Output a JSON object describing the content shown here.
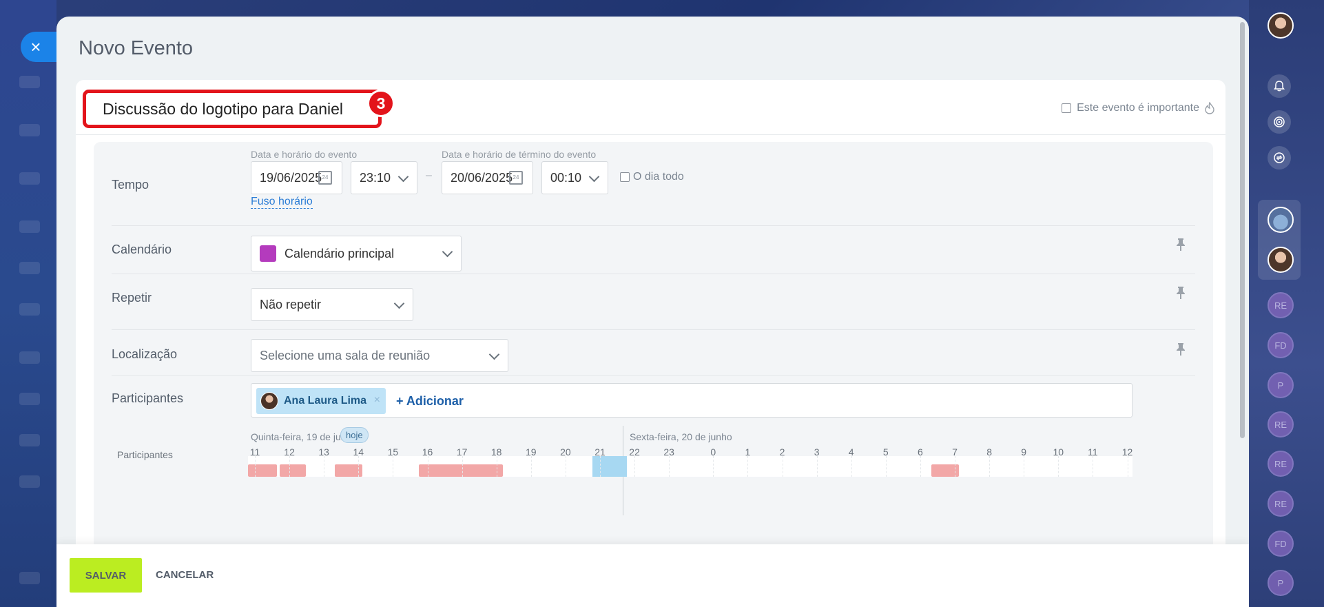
{
  "window": {
    "close_icon": "×"
  },
  "page": {
    "title": "Novo Evento"
  },
  "event": {
    "name": "Discussão do logotipo para Daniel",
    "step_badge": "3",
    "important_label": "Este evento é importante",
    "important_checked": false
  },
  "form": {
    "time": {
      "label": "Tempo",
      "start_caption": "Data e horário do evento",
      "end_caption": "Data e horário de término do evento",
      "start_date": "19/06/2025",
      "start_time": "23:10",
      "separator": "–",
      "end_date": "20/06/2025",
      "end_time": "00:10",
      "all_day_label": "O dia todo",
      "timezone_link": "Fuso horário",
      "calendar_icon_text": "24"
    },
    "calendar": {
      "label": "Calendário",
      "value": "Calendário principal",
      "color": "#b43bbd"
    },
    "repeat": {
      "label": "Repetir",
      "value": "Não repetir"
    },
    "location": {
      "label": "Localização",
      "placeholder": "Selecione uma sala de reunião"
    },
    "participants": {
      "label": "Participantes",
      "chips": [
        {
          "name": "Ana Laura Lima",
          "remove": "×"
        }
      ],
      "add_label": "+ Adicionar"
    }
  },
  "timeline": {
    "participants_label": "Participantes",
    "day1": "Quinta-feira, 19 de junho",
    "today_badge": "hoje",
    "day2": "Sexta-feira, 20 de junho",
    "hours": [
      "11",
      "12",
      "13",
      "14",
      "15",
      "16",
      "17",
      "18",
      "19",
      "20",
      "21",
      "22",
      "23",
      "0",
      "1",
      "2",
      "3",
      "4",
      "5",
      "6",
      "7",
      "8",
      "9",
      "10",
      "11",
      "12"
    ]
  },
  "footer": {
    "save_label": "SALVAR",
    "cancel_label": "CANCELAR"
  },
  "right_bar": {
    "icons": [
      "bell-icon",
      "target-icon",
      "sync-icon"
    ],
    "initials": [
      "RE",
      "FD",
      "P",
      "RE",
      "RE",
      "RE",
      "FD",
      "P"
    ]
  },
  "colors": {
    "accent_blue": "#1b83e8",
    "highlight_red": "#e3141b",
    "save_green": "#bbed21",
    "busy": "#f2a7a7"
  }
}
